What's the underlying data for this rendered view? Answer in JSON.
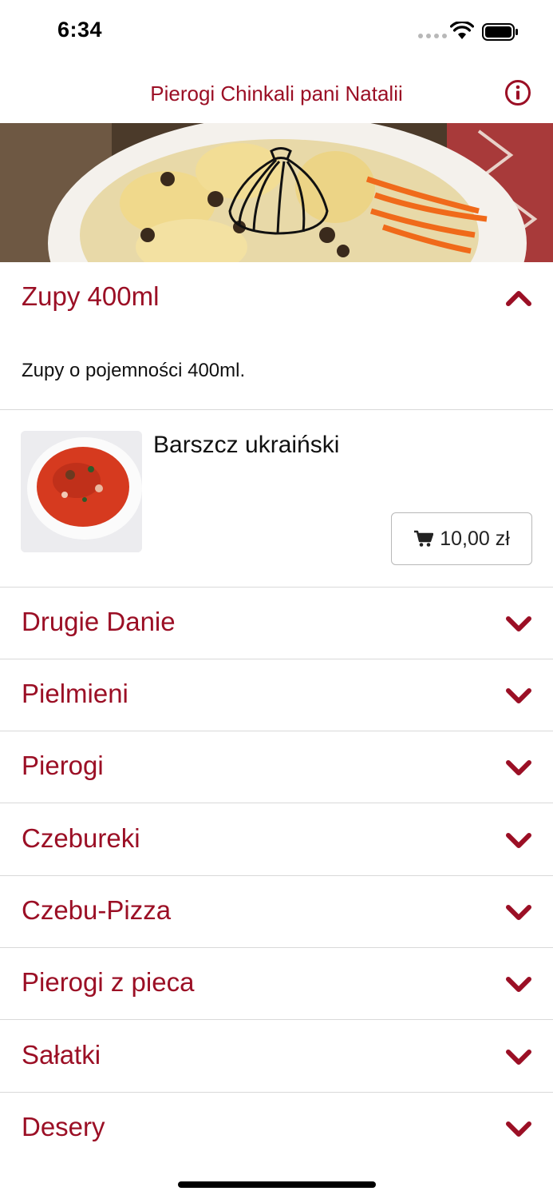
{
  "status_bar": {
    "time": "6:34"
  },
  "header": {
    "title": "Pierogi Chinkali pani Natalii",
    "info_icon": "info-icon"
  },
  "hero": {
    "logo_icon": "dumpling-logo-icon"
  },
  "open_section": {
    "title": "Zupy 400ml",
    "description": "Zupy o pojemności 400ml.",
    "products": [
      {
        "name": "Barszcz ukraiński",
        "price": "10,00 zł",
        "cart_icon": "cart-icon"
      }
    ]
  },
  "sections": [
    {
      "title": "Drugie Danie"
    },
    {
      "title": "Pielmieni"
    },
    {
      "title": "Pierogi"
    },
    {
      "title": "Czebureki"
    },
    {
      "title": "Czebu-Pizza"
    },
    {
      "title": "Pierogi z pieca"
    },
    {
      "title": "Sałatki"
    },
    {
      "title": "Desery"
    }
  ],
  "colors": {
    "accent": "#9b0f25",
    "divider": "#d9d9d9"
  }
}
